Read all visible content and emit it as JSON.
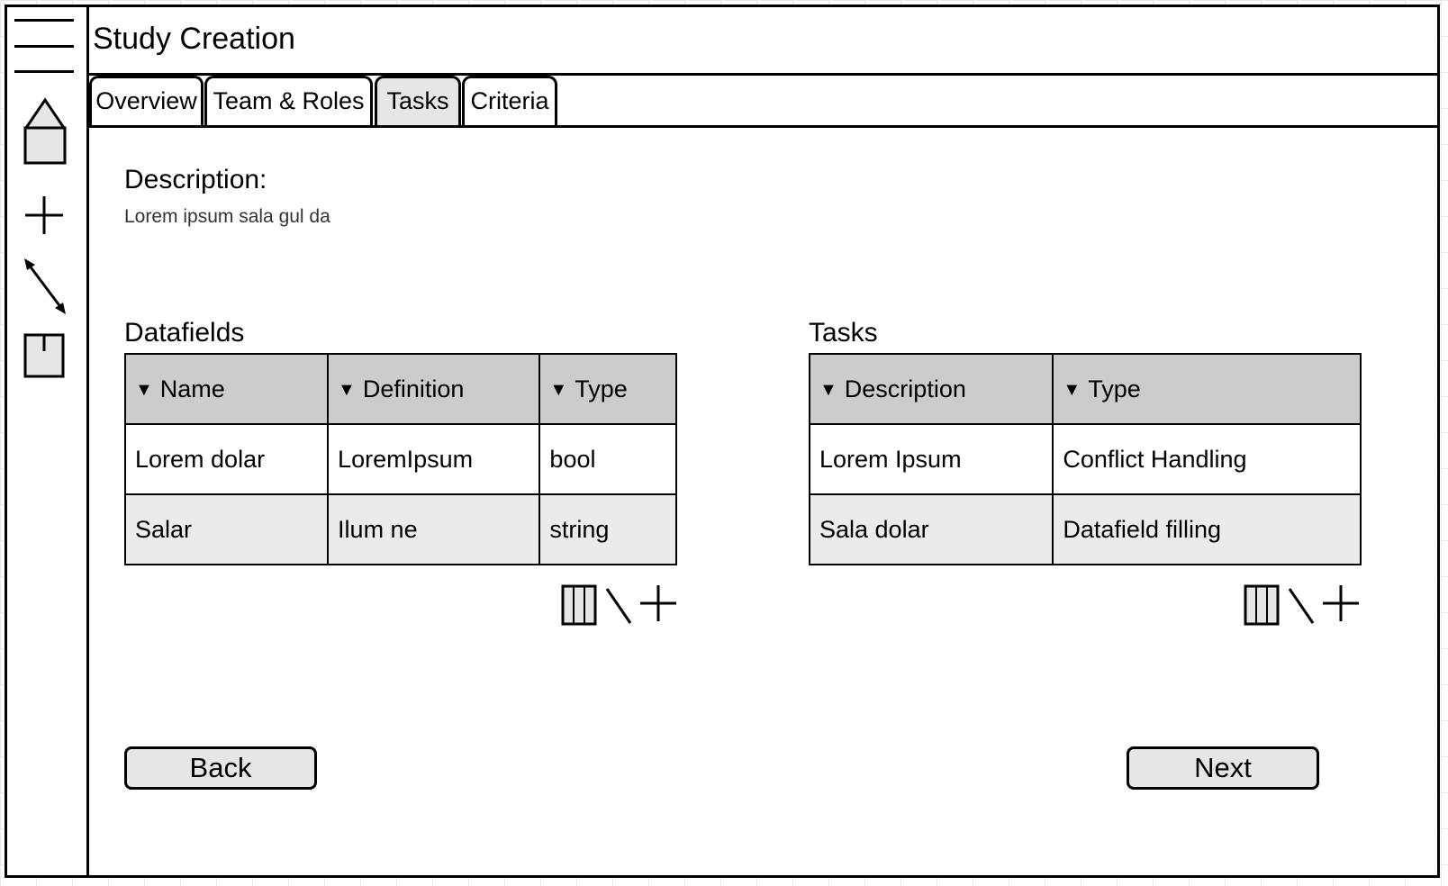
{
  "window": {
    "title": "Study Creation"
  },
  "sidebar": {
    "items": [
      {
        "icon": "menu-icon"
      },
      {
        "icon": "home-icon"
      },
      {
        "icon": "add-icon"
      },
      {
        "icon": "resize-arrow-icon"
      },
      {
        "icon": "document-icon"
      }
    ]
  },
  "tabs": [
    {
      "label": "Overview",
      "active": false
    },
    {
      "label": "Team & Roles",
      "active": false
    },
    {
      "label": "Tasks",
      "active": true
    },
    {
      "label": "Criteria",
      "active": false
    }
  ],
  "description": {
    "label": "Description:",
    "text": "Lorem ipsum sala gul da"
  },
  "datafields": {
    "title": "Datafields",
    "columns": [
      "Name",
      "Definition",
      "Type"
    ],
    "rows": [
      [
        "Lorem dolar",
        "LoremIpsum",
        "bool"
      ],
      [
        "Salar",
        "Ilum ne",
        "string"
      ]
    ],
    "tools": [
      "columns-icon",
      "edit-icon",
      "add-icon"
    ]
  },
  "tasks": {
    "title": "Tasks",
    "columns": [
      "Description",
      "Type"
    ],
    "rows": [
      [
        "Lorem Ipsum",
        "Conflict Handling"
      ],
      [
        "Sala dolar",
        "Datafield filling"
      ]
    ],
    "tools": [
      "columns-icon",
      "edit-icon",
      "add-icon"
    ]
  },
  "buttons": {
    "back": "Back",
    "next": "Next"
  },
  "colors": {
    "header_fill": "#cccccc",
    "alt_row_fill": "#ebebeb",
    "active_tab_fill": "#e6e6e6",
    "border": "#000000"
  }
}
